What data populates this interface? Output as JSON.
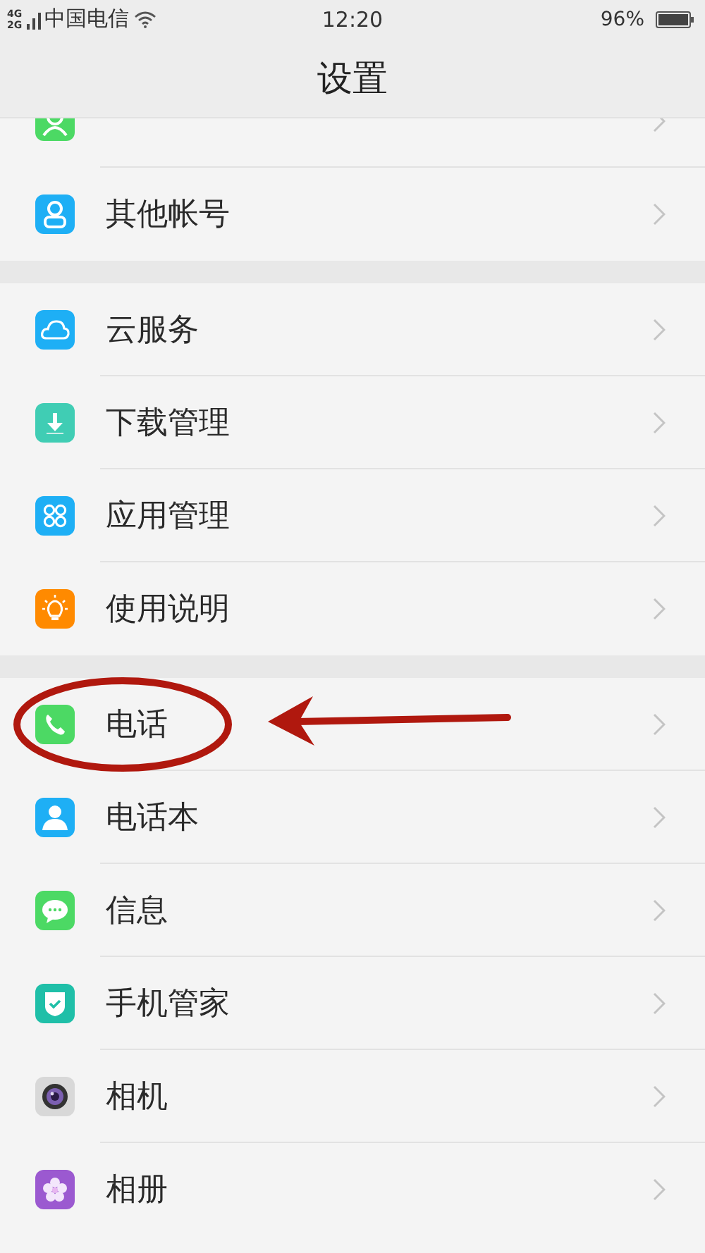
{
  "status_bar": {
    "network_top": "4G",
    "network_bottom": "2G",
    "carrier": "中国电信",
    "time": "12:20",
    "battery": "96%"
  },
  "header": {
    "title": "设置"
  },
  "groups": [
    {
      "partial_top_item": true,
      "items": [
        {
          "label": "其他帐号",
          "highlighted": false
        }
      ]
    },
    {
      "items": [
        {
          "label": "云服务",
          "highlighted": false
        },
        {
          "label": "下载管理",
          "highlighted": false
        },
        {
          "label": "应用管理",
          "highlighted": false
        },
        {
          "label": "使用说明",
          "highlighted": false
        }
      ]
    },
    {
      "items": [
        {
          "label": "电话",
          "highlighted": true
        },
        {
          "label": "电话本",
          "highlighted": false
        },
        {
          "label": "信息",
          "highlighted": false
        },
        {
          "label": "手机管家",
          "highlighted": false
        },
        {
          "label": "相机",
          "highlighted": false
        },
        {
          "label": "相册",
          "highlighted": false
        }
      ]
    }
  ]
}
